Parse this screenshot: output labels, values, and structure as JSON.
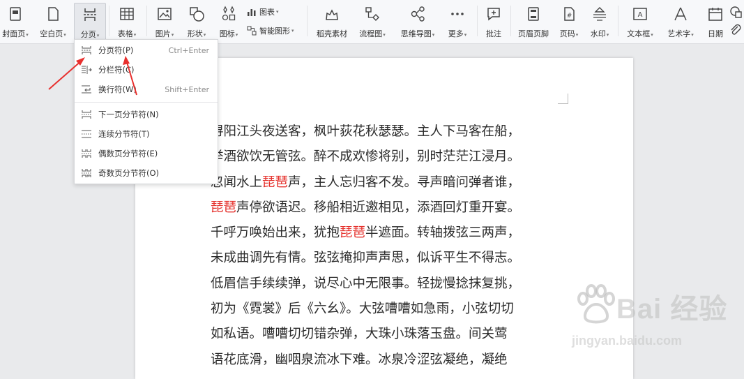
{
  "toolbar": {
    "items": [
      {
        "label": "封面页",
        "icon": "cover-page-icon",
        "caret": true
      },
      {
        "label": "空白页",
        "icon": "blank-page-icon",
        "caret": true
      },
      {
        "label": "分页",
        "icon": "page-break-icon",
        "caret": true,
        "active": true
      },
      {
        "label": "表格",
        "icon": "table-icon",
        "caret": true
      },
      {
        "label": "图片",
        "icon": "image-icon",
        "caret": true
      },
      {
        "label": "形状",
        "icon": "shape-icon",
        "caret": true
      },
      {
        "label": "图标",
        "icon": "icon-library-icon",
        "caret": true
      },
      {
        "label": "稻壳素材",
        "icon": "docer-material-icon",
        "caret": false
      },
      {
        "label": "流程图",
        "icon": "flowchart-icon",
        "caret": true
      },
      {
        "label": "思维导图",
        "icon": "mindmap-icon",
        "caret": true
      },
      {
        "label": "更多",
        "icon": "more-icon",
        "caret": true
      },
      {
        "label": "批注",
        "icon": "comment-icon",
        "caret": false
      },
      {
        "label": "页眉页脚",
        "icon": "header-footer-icon",
        "caret": false
      },
      {
        "label": "页码",
        "icon": "page-number-icon",
        "caret": true
      },
      {
        "label": "水印",
        "icon": "watermark-icon",
        "caret": true
      },
      {
        "label": "文本框",
        "icon": "textbox-icon",
        "caret": true
      },
      {
        "label": "艺术字",
        "icon": "wordart-icon",
        "caret": true
      },
      {
        "label": "日期",
        "icon": "date-icon",
        "caret": false
      }
    ],
    "chart_label": "图表",
    "smart_graphic_label": "智能图形"
  },
  "dropdown": {
    "items": [
      {
        "label": "分页符(P)",
        "shortcut": "Ctrl+Enter",
        "icon": "page-break-symbol-icon"
      },
      {
        "label": "分栏符(C)",
        "shortcut": "",
        "icon": "column-break-icon"
      },
      {
        "label": "换行符(W)",
        "shortcut": "Shift+Enter",
        "icon": "line-break-icon"
      },
      {
        "label": "下一页分节符(N)",
        "shortcut": "",
        "icon": "next-page-section-break-icon"
      },
      {
        "label": "连续分节符(T)",
        "shortcut": "",
        "icon": "continuous-section-break-icon"
      },
      {
        "label": "偶数页分节符(E)",
        "shortcut": "",
        "icon": "even-page-section-break-icon"
      },
      {
        "label": "奇数页分节符(O)",
        "shortcut": "",
        "icon": "odd-page-section-break-icon"
      }
    ]
  },
  "document": {
    "lines": [
      [
        {
          "t": "浔阳江头夜送客，枫叶荻花秋瑟瑟。主人下马客在船，"
        }
      ],
      [
        {
          "t": "举酒欲饮无管弦。醉不成欢惨将别，别时茫茫江浸月。"
        }
      ],
      [
        {
          "t": "忽闻水上"
        },
        {
          "t": "琵琶",
          "hl": true
        },
        {
          "t": "声，主人忘归客不发。寻声暗问弹者谁，"
        }
      ],
      [
        {
          "t": "琵琶",
          "hl": true
        },
        {
          "t": "声停欲语迟。移船相近邀相见，添酒回灯重开宴。"
        }
      ],
      [
        {
          "t": "千呼万唤始出来，犹抱"
        },
        {
          "t": "琵琶",
          "hl": true
        },
        {
          "t": "半遮面。转轴拨弦三两声，"
        }
      ],
      [
        {
          "t": "未成曲调先有情。弦弦掩抑声声思，似诉平生不得志。"
        }
      ],
      [
        {
          "t": "低眉信手续续弹，说尽心中无限事。轻拢慢捻抹复挑，"
        }
      ],
      [
        {
          "t": "初为《霓裳》后《六幺》。大弦嘈嘈如急雨，小弦切切"
        }
      ],
      [
        {
          "t": "如私语。嘈嘈切切错杂弹，大珠小珠落玉盘。间关莺"
        }
      ],
      [
        {
          "t": "语花底滑，幽咽泉流冰下难。冰泉冷涩弦凝绝，凝绝"
        }
      ]
    ],
    "highlight_color": "#e5322d"
  },
  "watermark": {
    "brand_text": "Bai 经验",
    "url": "jingyan.baidu.com"
  },
  "colors": {
    "toolbar_bg": "#f7f8fa",
    "arrow": "#e8302e",
    "canvas_bg": "#e9eaec"
  }
}
